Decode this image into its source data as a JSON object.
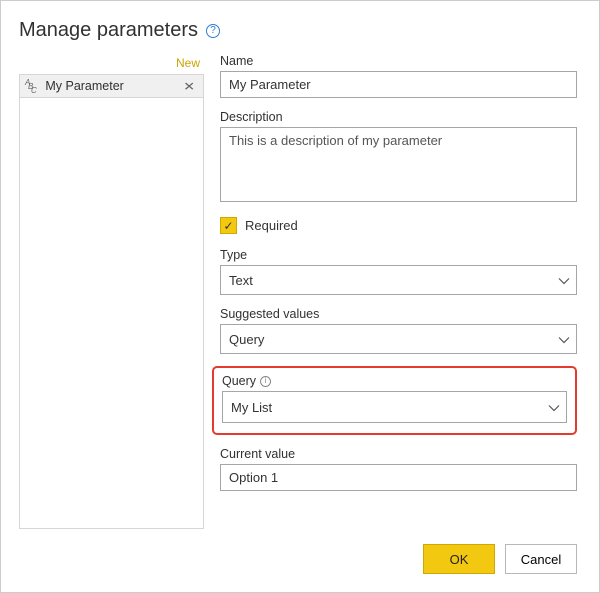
{
  "header": {
    "title": "Manage parameters"
  },
  "sidebar": {
    "new_label": "New",
    "items": [
      {
        "name": "My Parameter"
      }
    ]
  },
  "form": {
    "name": {
      "label": "Name",
      "value": "My Parameter"
    },
    "description": {
      "label": "Description",
      "value": "This is a description of my parameter"
    },
    "required": {
      "label": "Required",
      "checked": true
    },
    "type": {
      "label": "Type",
      "value": "Text"
    },
    "suggested_values": {
      "label": "Suggested values",
      "value": "Query"
    },
    "query": {
      "label": "Query",
      "value": "My List"
    },
    "current_value": {
      "label": "Current value",
      "value": "Option 1"
    }
  },
  "footer": {
    "ok": "OK",
    "cancel": "Cancel"
  }
}
